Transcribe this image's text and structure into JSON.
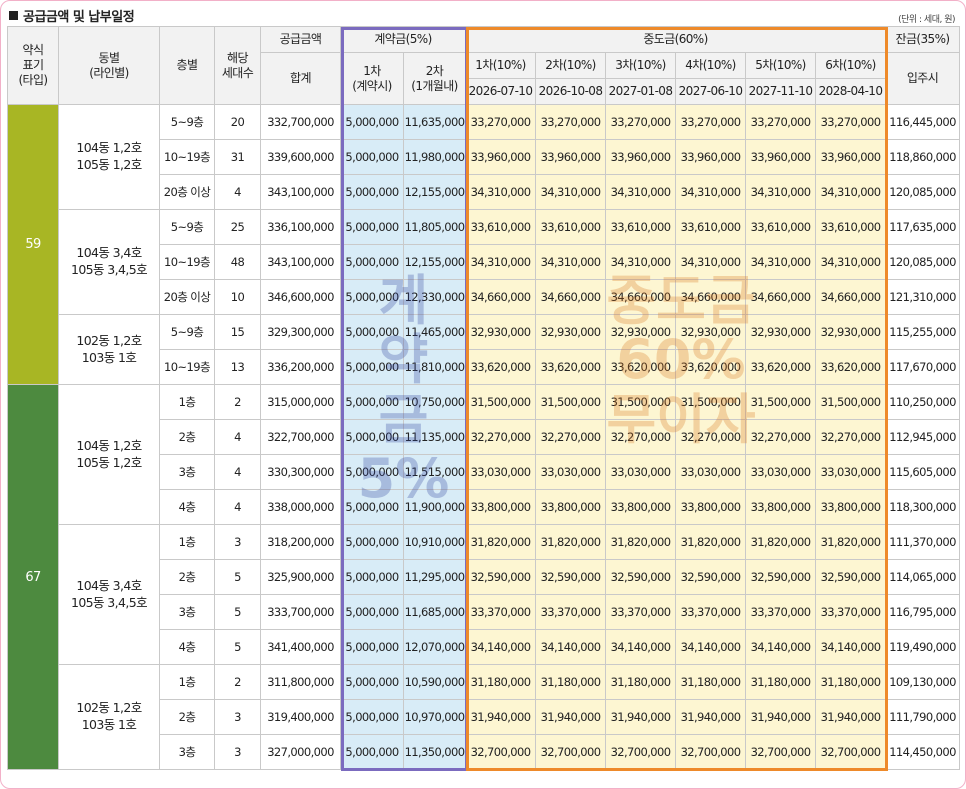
{
  "title": "공급금액 및 납부일정",
  "unit_note": "(단위 : 세대, 원)",
  "headers": {
    "type": "약식\n표기\n(타입)",
    "dong": "동별\n(라인별)",
    "floor": "층별",
    "units": "해당\n세대수",
    "supply": "공급금액",
    "supply_total": "합계",
    "contract": "계약금(5%)",
    "contract_1": "1차\n(계약시)",
    "contract_2": "2차\n(1개월내)",
    "middle": "중도금(60%)",
    "middle_items": [
      {
        "label": "1차(10%)",
        "date": "2026-07-10"
      },
      {
        "label": "2차(10%)",
        "date": "2026-10-08"
      },
      {
        "label": "3차(10%)",
        "date": "2027-01-08"
      },
      {
        "label": "4차(10%)",
        "date": "2027-06-10"
      },
      {
        "label": "5차(10%)",
        "date": "2027-11-10"
      },
      {
        "label": "6차(10%)",
        "date": "2028-04-10"
      }
    ],
    "balance": "잔금(35%)",
    "balance_sub": "입주시"
  },
  "watermarks": {
    "contract": "계\n약\n금\n5%",
    "middle": "중도금\n60%\n무이자"
  },
  "type_groups": [
    {
      "type": "59",
      "dong_groups": [
        {
          "dong": "104동 1,2호\n105동 1,2호",
          "rows": [
            {
              "floor": "5~9층",
              "units": "20",
              "total": "332,700,000",
              "c1": "5,000,000",
              "c2": "11,635,000",
              "mid": "33,270,000",
              "bal": "116,445,000"
            },
            {
              "floor": "10~19층",
              "units": "31",
              "total": "339,600,000",
              "c1": "5,000,000",
              "c2": "11,980,000",
              "mid": "33,960,000",
              "bal": "118,860,000"
            },
            {
              "floor": "20층 이상",
              "units": "4",
              "total": "343,100,000",
              "c1": "5,000,000",
              "c2": "12,155,000",
              "mid": "34,310,000",
              "bal": "120,085,000"
            }
          ]
        },
        {
          "dong": "104동 3,4호\n105동 3,4,5호",
          "rows": [
            {
              "floor": "5~9층",
              "units": "25",
              "total": "336,100,000",
              "c1": "5,000,000",
              "c2": "11,805,000",
              "mid": "33,610,000",
              "bal": "117,635,000"
            },
            {
              "floor": "10~19층",
              "units": "48",
              "total": "343,100,000",
              "c1": "5,000,000",
              "c2": "12,155,000",
              "mid": "34,310,000",
              "bal": "120,085,000"
            },
            {
              "floor": "20층 이상",
              "units": "10",
              "total": "346,600,000",
              "c1": "5,000,000",
              "c2": "12,330,000",
              "mid": "34,660,000",
              "bal": "121,310,000"
            }
          ]
        },
        {
          "dong": "102동 1,2호\n103동 1호",
          "rows": [
            {
              "floor": "5~9층",
              "units": "15",
              "total": "329,300,000",
              "c1": "5,000,000",
              "c2": "11,465,000",
              "mid": "32,930,000",
              "bal": "115,255,000"
            },
            {
              "floor": "10~19층",
              "units": "13",
              "total": "336,200,000",
              "c1": "5,000,000",
              "c2": "11,810,000",
              "mid": "33,620,000",
              "bal": "117,670,000"
            }
          ]
        }
      ]
    },
    {
      "type": "67",
      "dong_groups": [
        {
          "dong": "104동 1,2호\n105동 1,2호",
          "rows": [
            {
              "floor": "1층",
              "units": "2",
              "total": "315,000,000",
              "c1": "5,000,000",
              "c2": "10,750,000",
              "mid": "31,500,000",
              "bal": "110,250,000"
            },
            {
              "floor": "2층",
              "units": "4",
              "total": "322,700,000",
              "c1": "5,000,000",
              "c2": "11,135,000",
              "mid": "32,270,000",
              "bal": "112,945,000"
            },
            {
              "floor": "3층",
              "units": "4",
              "total": "330,300,000",
              "c1": "5,000,000",
              "c2": "11,515,000",
              "mid": "33,030,000",
              "bal": "115,605,000"
            },
            {
              "floor": "4층",
              "units": "4",
              "total": "338,000,000",
              "c1": "5,000,000",
              "c2": "11,900,000",
              "mid": "33,800,000",
              "bal": "118,300,000"
            }
          ]
        },
        {
          "dong": "104동 3,4호\n105동 3,4,5호",
          "rows": [
            {
              "floor": "1층",
              "units": "3",
              "total": "318,200,000",
              "c1": "5,000,000",
              "c2": "10,910,000",
              "mid": "31,820,000",
              "bal": "111,370,000"
            },
            {
              "floor": "2층",
              "units": "5",
              "total": "325,900,000",
              "c1": "5,000,000",
              "c2": "11,295,000",
              "mid": "32,590,000",
              "bal": "114,065,000"
            },
            {
              "floor": "3층",
              "units": "5",
              "total": "333,700,000",
              "c1": "5,000,000",
              "c2": "11,685,000",
              "mid": "33,370,000",
              "bal": "116,795,000"
            },
            {
              "floor": "4층",
              "units": "5",
              "total": "341,400,000",
              "c1": "5,000,000",
              "c2": "12,070,000",
              "mid": "34,140,000",
              "bal": "119,490,000"
            }
          ]
        },
        {
          "dong": "102동 1,2호\n103동 1호",
          "rows": [
            {
              "floor": "1층",
              "units": "2",
              "total": "311,800,000",
              "c1": "5,000,000",
              "c2": "10,590,000",
              "mid": "31,180,000",
              "bal": "109,130,000"
            },
            {
              "floor": "2층",
              "units": "3",
              "total": "319,400,000",
              "c1": "5,000,000",
              "c2": "10,970,000",
              "mid": "31,940,000",
              "bal": "111,790,000"
            },
            {
              "floor": "3층",
              "units": "3",
              "total": "327,000,000",
              "c1": "5,000,000",
              "c2": "11,350,000",
              "mid": "32,700,000",
              "bal": "114,450,000"
            }
          ]
        }
      ]
    }
  ],
  "colors": {
    "type59": "#a8b624",
    "type67": "#4d8a3f",
    "contract_frame": "#7b6bbf",
    "middle_frame": "#ee8a2a",
    "contract_fill": "#d8ecf7",
    "middle_fill": "#fdf6d2"
  }
}
